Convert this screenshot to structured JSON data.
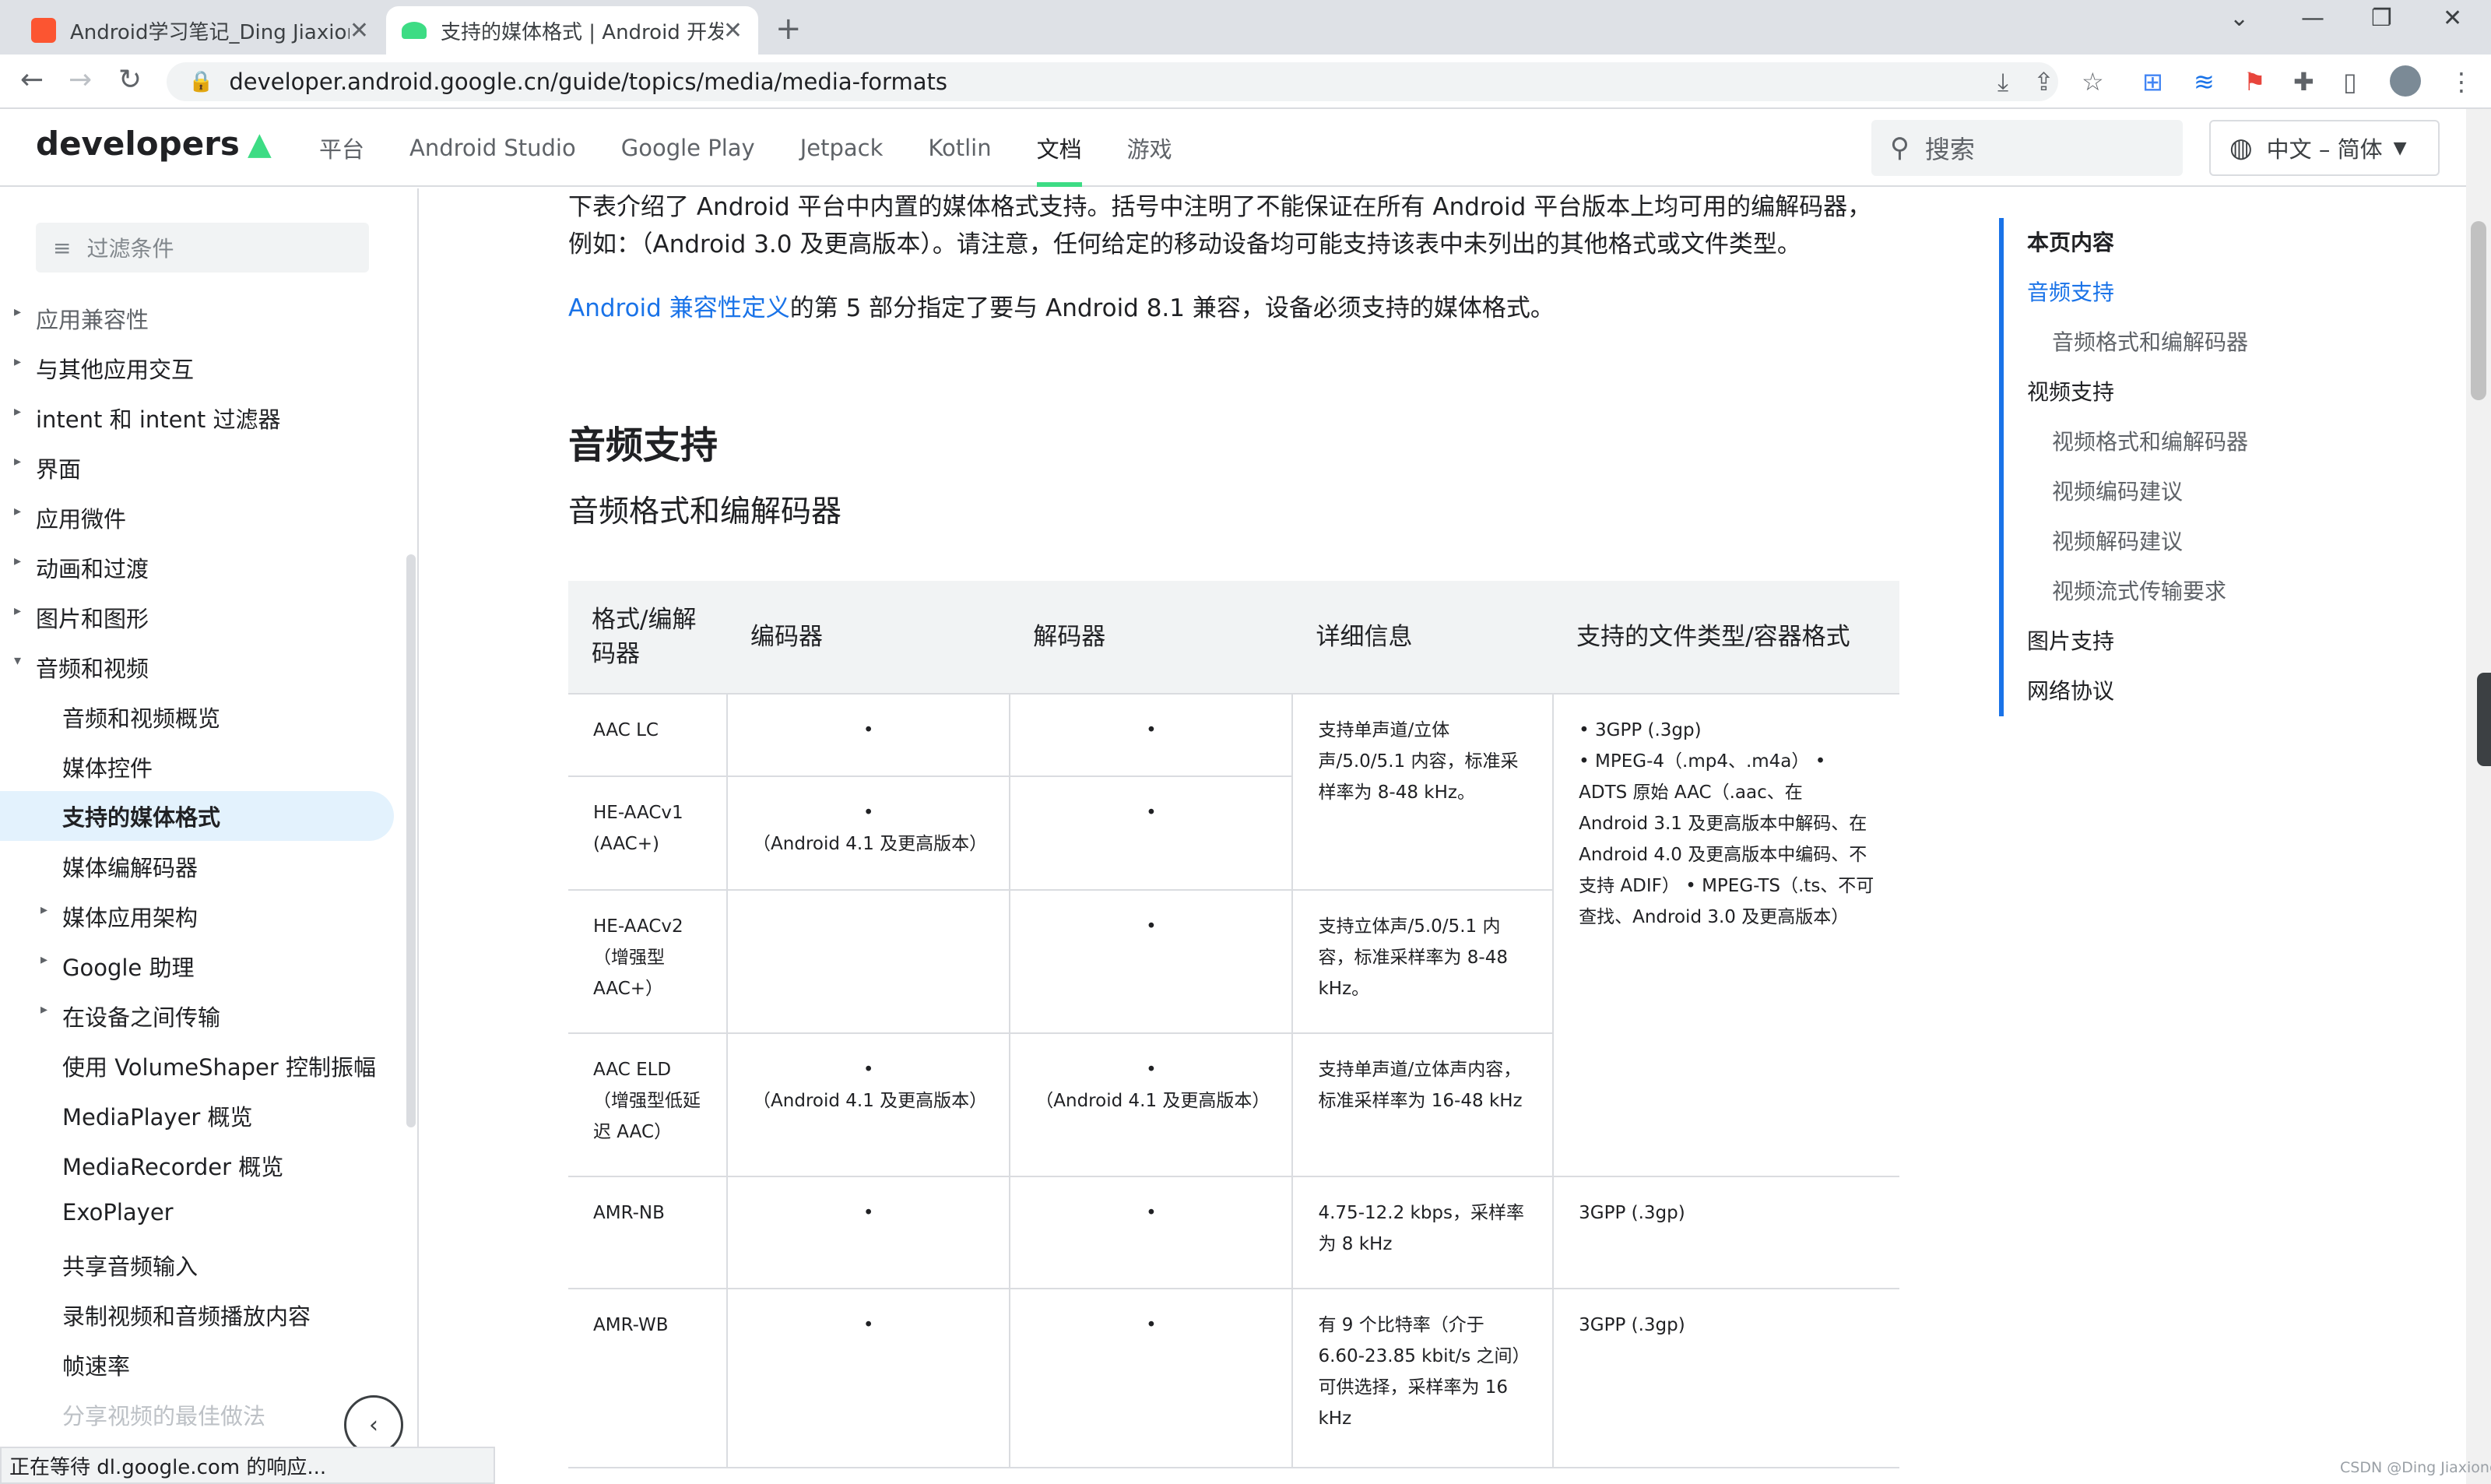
{
  "browser": {
    "tabs": [
      {
        "title": "Android学习笔记_Ding Jiaxiong",
        "favicon_color": "#fc5531"
      },
      {
        "title": "支持的媒体格式 | Android 开发者",
        "favicon_color": "#3ddc84"
      }
    ],
    "new_tab": "+",
    "url": "developer.android.google.cn/guide/topics/media/media-formats",
    "status_text": "正在等待 dl.google.com 的响应..."
  },
  "site": {
    "logo_text": "developers",
    "nav": [
      "平台",
      "Android Studio",
      "Google Play",
      "Jetpack",
      "Kotlin",
      "文档",
      "游戏"
    ],
    "active_nav": "文档",
    "search_placeholder": "搜索",
    "language": "中文 – 简体"
  },
  "sidebar": {
    "filter_placeholder": "过滤条件",
    "items": [
      {
        "label": "应用兼容性",
        "expandable": true,
        "level": 0
      },
      {
        "label": "与其他应用交互",
        "expandable": true,
        "level": 0
      },
      {
        "label": "intent 和 intent 过滤器",
        "expandable": true,
        "level": 0
      },
      {
        "label": "界面",
        "expandable": true,
        "level": 0
      },
      {
        "label": "应用微件",
        "expandable": true,
        "level": 0
      },
      {
        "label": "动画和过渡",
        "expandable": true,
        "level": 0
      },
      {
        "label": "图片和图形",
        "expandable": true,
        "level": 0
      },
      {
        "label": "音频和视频",
        "expandable": true,
        "expanded": true,
        "level": 0
      },
      {
        "label": "音频和视频概览",
        "level": 1
      },
      {
        "label": "媒体控件",
        "level": 1
      },
      {
        "label": "支持的媒体格式",
        "level": 1,
        "active": true
      },
      {
        "label": "媒体编解码器",
        "level": 1
      },
      {
        "label": "媒体应用架构",
        "expandable": true,
        "level": 1
      },
      {
        "label": "Google 助理",
        "expandable": true,
        "level": 1
      },
      {
        "label": "在设备之间传输",
        "expandable": true,
        "level": 1
      },
      {
        "label": "使用 VolumeShaper 控制振幅",
        "level": 1
      },
      {
        "label": "MediaPlayer 概览",
        "level": 1
      },
      {
        "label": "MediaRecorder 概览",
        "level": 1
      },
      {
        "label": "ExoPlayer",
        "level": 1
      },
      {
        "label": "共享音频输入",
        "level": 1
      },
      {
        "label": "录制视频和音频播放内容",
        "level": 1
      },
      {
        "label": "帧速率",
        "level": 1
      },
      {
        "label": "分享视频的最佳做法",
        "level": 1
      }
    ],
    "collapse_icon": "‹"
  },
  "main": {
    "intro": "下表介绍了 Android 平台中内置的媒体格式支持。括号中注明了不能保证在所有 Android 平台版本上均可用的编解码器，例如：（Android 3.0 及更高版本）。请注意，任何给定的移动设备均可能支持该表中未列出的其他格式或文件类型。",
    "cdd_link": "Android 兼容性定义",
    "cdd_text": "的第 5 部分指定了要与 Android 8.1 兼容，设备必须支持的媒体格式。",
    "heading": "音频支持",
    "subheading": "音频格式和编解码器",
    "table": {
      "headers": [
        "格式/编解码器",
        "编码器",
        "解码器",
        "详细信息",
        "支持的文件类型/容器格式"
      ],
      "rows": [
        {
          "format": "AAC LC",
          "encoder": "•",
          "decoder": "•",
          "details": "支持单声道/立体声/5.0/5.1 内容，标准采样率为 8-48 kHz。",
          "containers": "• 3GPP (.3gp)\n• MPEG-4（.mp4、.m4a） • ADTS 原始 AAC（.aac、在 Android 3.1 及更高版本中解码、在 Android 4.0 及更高版本中编码、不支持 ADIF） • MPEG-TS（.ts、不可查找、Android 3.0 及更高版本）"
        },
        {
          "format": "HE-AACv1 (AAC+)",
          "encoder": "•\n（Android 4.1 及更高版本）",
          "decoder": "•"
        },
        {
          "format": "HE-AACv2（增强型 AAC+）",
          "encoder": "",
          "decoder": "•",
          "details": "支持立体声/5.0/5.1 内容，标准采样率为 8-48 kHz。"
        },
        {
          "format": "AAC ELD（增强型低延迟 AAC）",
          "encoder": "•\n（Android 4.1 及更高版本）",
          "decoder": "•\n（Android 4.1 及更高版本）",
          "details": "支持单声道/立体声内容，标准采样率为 16-48 kHz"
        },
        {
          "format": "AMR-NB",
          "encoder": "•",
          "decoder": "•",
          "details": "4.75-12.2 kbps，采样率为 8 kHz",
          "containers": "3GPP (.3gp)"
        },
        {
          "format": "AMR-WB",
          "encoder": "•",
          "decoder": "•",
          "details": "有 9 个比特率（介于 6.60-23.85 kbit/s 之间）可供选择，采样率为 16 kHz",
          "containers": "3GPP (.3gp)"
        }
      ]
    }
  },
  "toc": {
    "title": "本页内容",
    "items": [
      {
        "label": "音频支持",
        "level": 1
      },
      {
        "label": "音频格式和编解码器",
        "level": 2
      },
      {
        "label": "视频支持",
        "level": 1
      },
      {
        "label": "视频格式和编解码器",
        "level": 2
      },
      {
        "label": "视频编码建议",
        "level": 2
      },
      {
        "label": "视频解码建议",
        "level": 2
      },
      {
        "label": "视频流式传输要求",
        "level": 2
      },
      {
        "label": "图片支持",
        "level": 1
      },
      {
        "label": "网络协议",
        "level": 1
      }
    ]
  },
  "watermark": "CSDN @Ding Jiaxiong",
  "colors": {
    "accent": "#1a73e8",
    "android_green": "#3ddc84",
    "active_bg": "#e3f2fd"
  }
}
